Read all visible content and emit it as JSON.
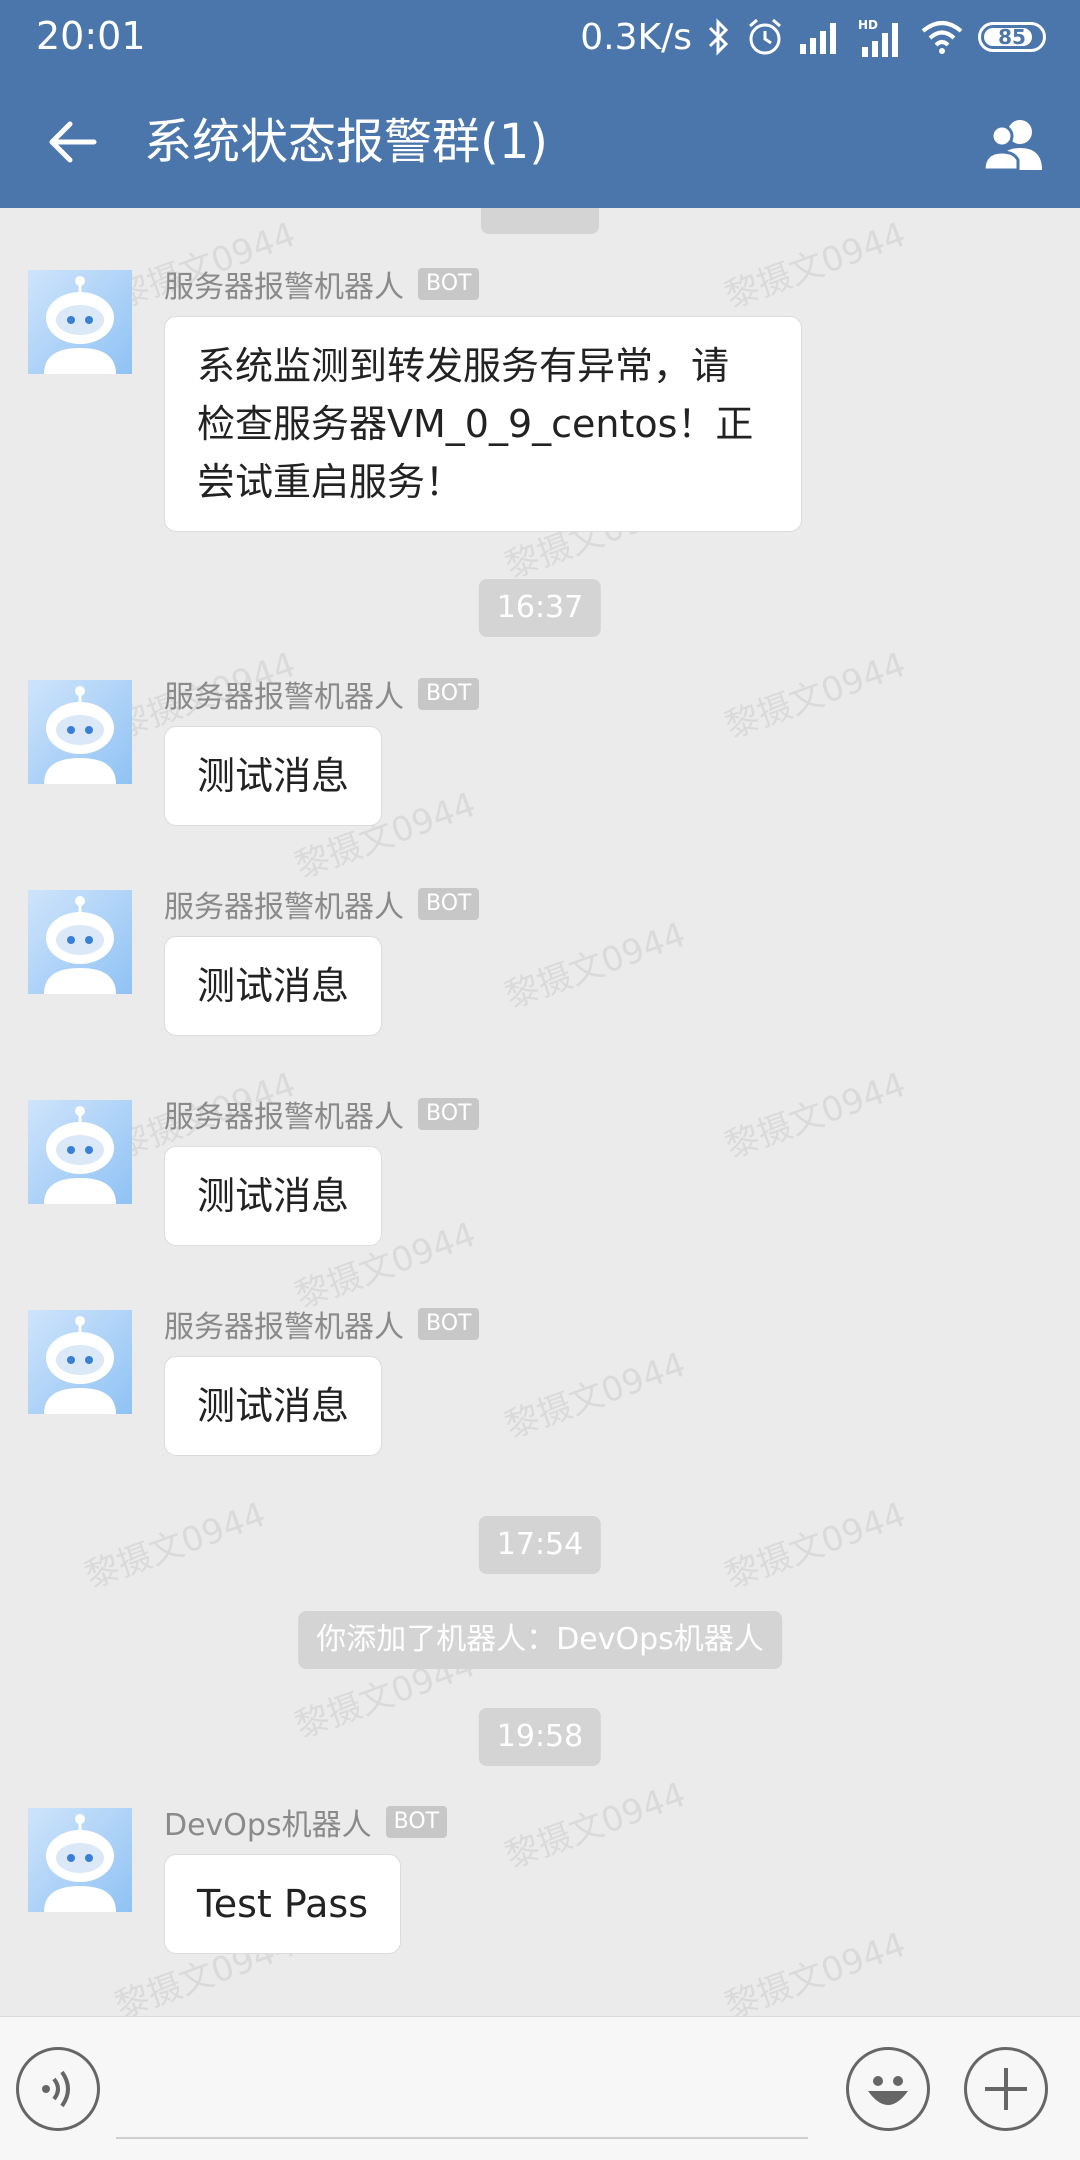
{
  "status_bar": {
    "time": "20:01",
    "net_speed": "0.3K/s",
    "battery": "85",
    "battery_fraction": 0.85,
    "icons": [
      "bluetooth-icon",
      "alarm-icon",
      "signal-icon",
      "hd-signal-icon",
      "wifi-icon",
      "battery-icon"
    ]
  },
  "header": {
    "title": "系统状态报警群(1)",
    "back_icon": "back-arrow-icon",
    "members_icon": "group-members-icon"
  },
  "chat": {
    "watermark": "黎摄文0944",
    "items": [
      {
        "kind": "time",
        "text": "16:37"
      },
      {
        "kind": "time",
        "text": "17:54"
      },
      {
        "kind": "time",
        "text": "19:58"
      }
    ],
    "messages": [
      {
        "sender": "服务器报警机器人",
        "badge": "BOT",
        "text": "系统监测到转发服务有异常，请\n检查服务器VM_0_9_centos！正\n尝试重启服务！"
      },
      {
        "sender": "服务器报警机器人",
        "badge": "BOT",
        "text": "测试消息"
      },
      {
        "sender": "服务器报警机器人",
        "badge": "BOT",
        "text": "测试消息"
      },
      {
        "sender": "服务器报警机器人",
        "badge": "BOT",
        "text": "测试消息"
      },
      {
        "sender": "服务器报警机器人",
        "badge": "BOT",
        "text": "测试消息"
      },
      {
        "sender": "DevOps机器人",
        "badge": "BOT",
        "text": "Test Pass"
      }
    ],
    "notice": "你添加了机器人：DevOps机器人"
  },
  "input_bar": {
    "placeholder": "",
    "voice_icon": "voice-icon",
    "emoji_icon": "emoji-icon",
    "plus_icon": "plus-icon"
  },
  "colors": {
    "header_bg": "#4b76ac",
    "chat_bg": "#ebebeb",
    "bubble_bg": "#ffffff"
  }
}
